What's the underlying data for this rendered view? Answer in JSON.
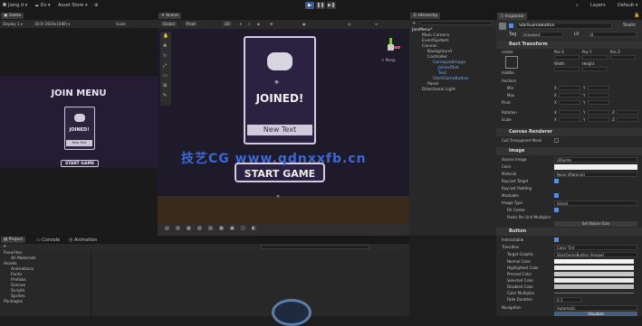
{
  "toolbar": {
    "account": "Jiang d",
    "cloud": "Dv",
    "asset_store": "Asset Store",
    "layers": "Layers",
    "layout": "Default",
    "play": "Play",
    "pause": "Pause",
    "step": "Step"
  },
  "game": {
    "tab": "Game",
    "display": "Display 1",
    "aspect": "16:9 (1920x1080)",
    "scale": "Scale",
    "menu_title": "JOIN MENU",
    "card_text": "JOINED!",
    "card_sub": "New Text",
    "button": "START GAME"
  },
  "scene": {
    "tab": "Scene",
    "mode": "Global",
    "pivot": "Pivot",
    "twod": "2D",
    "persp": "< Persp",
    "card_text": "JOINED!",
    "card_sub": "New Text",
    "button": "START GAME"
  },
  "hierarchy": {
    "tab": "Hierarchy",
    "items": [
      "JoinMenu*",
      "Main Camera",
      "EventSystem",
      "Canvas",
      "Background",
      "Controller",
      "GamepadImage",
      "JoinedText",
      "Text",
      "StartGameButton",
      "Panel",
      "Directional Light"
    ]
  },
  "project": {
    "tab": "Project",
    "console": "Console",
    "animation": "Animation",
    "items": [
      "Favorites",
      "All Materials",
      "Assets",
      "Animations",
      "Fonts",
      "Prefabs",
      "Scenes",
      "Scripts",
      "Sprites",
      "Packages"
    ]
  },
  "inspector": {
    "tab": "Inspector",
    "object_name": "StartGameButton",
    "static": "Static",
    "tag_label": "Tag",
    "tag_value": "Untagged",
    "layer_label": "Layer",
    "layer_value": "UI",
    "rect_transform": "Rect Transform",
    "center": "center",
    "middle": "middle",
    "pos_x": "Pos X",
    "pos_y": "Pos Y",
    "pos_z": "Pos Z",
    "width": "Width",
    "height": "Height",
    "anchors": "Anchors",
    "min": "Min",
    "max": "Max",
    "pivot": "Pivot",
    "rotation": "Rotation",
    "scale": "Scale",
    "x": "X",
    "y": "Y",
    "z": "Z",
    "canvas_renderer": "Canvas Renderer",
    "cull": "Cull Transparent Mesh",
    "image": "Image",
    "source_image": "Source Image",
    "source_value": "UISprite",
    "color": "Color",
    "material": "Material",
    "material_value": "None (Material)",
    "raycast": "Raycast Target",
    "raycast_padding": "Raycast Padding",
    "maskable": "Maskable",
    "image_type": "Image Type",
    "image_type_value": "Sliced",
    "fill_center": "Fill Center",
    "pixels_per_unit": "Pixels Per Unit Multiplier",
    "native": "Set Native Size",
    "button": "Button",
    "interactable": "Interactable",
    "transition": "Transition",
    "transition_value": "Color Tint",
    "target_graphic": "Target Graphic",
    "target_value": "StartGameButton (Image)",
    "normal": "Normal Color",
    "highlighted": "Highlighted Color",
    "pressed": "Pressed Color",
    "selected": "Selected Color",
    "disabled": "Disabled Color",
    "multiplier": "Color Multiplier",
    "fade": "Fade Duration",
    "fade_value": "0.1",
    "navigation": "Navigation",
    "navigation_value": "Automatic",
    "visualize": "Visualize",
    "on_click": "On Click ()"
  },
  "watermark": "技艺CG www.qdnxxfb.cn"
}
